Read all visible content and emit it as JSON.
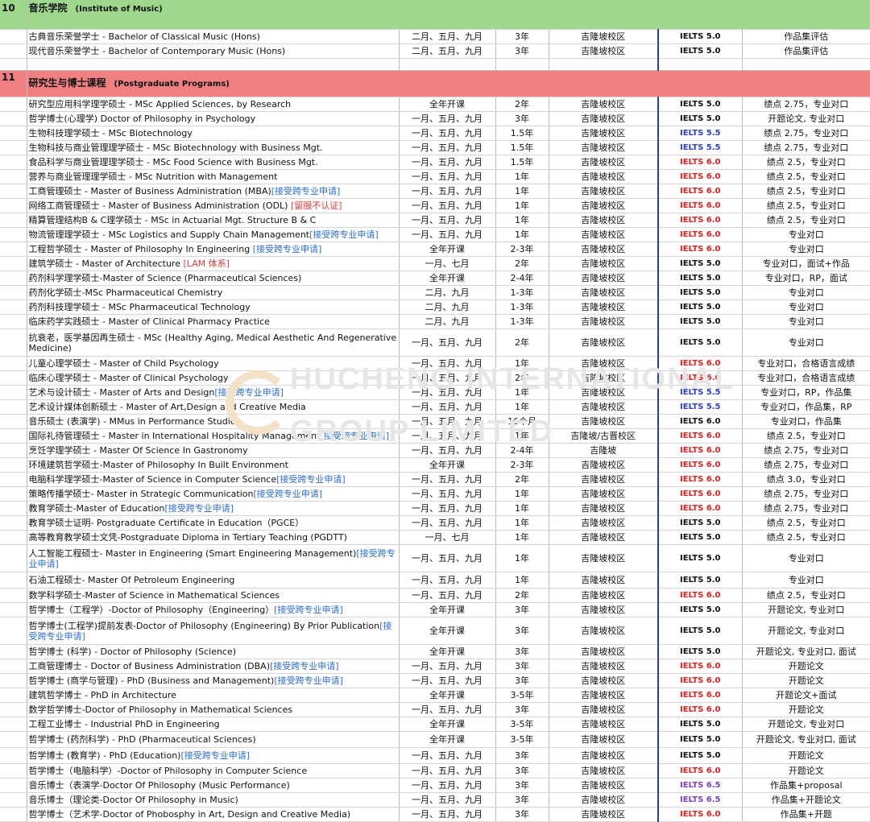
{
  "colors": {
    "section_green": "#9fd88c",
    "section_red": "#ef7f80",
    "tag_blue": "#2e6fd6",
    "tag_red": "#e03a3a",
    "ielts_red": "#e02020",
    "ielts_blue": "#2b3fd0",
    "ielts_purple": "#7a3fc0"
  },
  "watermark": {
    "line1": "HUCHENG INTERNATIONAL",
    "line2": "GROUP LIMITED"
  },
  "sections": [
    {
      "num": "10",
      "title_cn": "音乐学院",
      "title_en": "(Institute of Music)",
      "color": "green",
      "rows": [
        {
          "name": "古典音乐荣誉学士 - Bachelor of Classical Music (Hons)",
          "tag": "",
          "intake": "二月、五月、九月",
          "duration": "3年",
          "campus": "吉隆坡校区",
          "ielts": "IELTS 5.0",
          "level": "black",
          "note": "作品集评估"
        },
        {
          "name": "现代音乐荣誉学士 - Bachelor of Contemporary Music (Hons)",
          "tag": "",
          "intake": "二月、五月、九月",
          "duration": "3年",
          "campus": "吉隆坡校区",
          "ielts": "IELTS 5.0",
          "level": "black",
          "note": "作品集评估"
        }
      ]
    },
    {
      "num": "11",
      "title_cn": "研究生与博士课程",
      "title_en": "(Postgraduate Programs)",
      "color": "red",
      "rows": [
        {
          "name": "研究型应用科学理学硕士 - MSc Applied Sciences, by Research",
          "tag": "",
          "intake": "全年开课",
          "duration": "2年",
          "campus": "吉隆坡校区",
          "ielts": "IELTS 5.0",
          "level": "black",
          "note": "绩点 2.75，专业对口"
        },
        {
          "name": "哲学博士(心理学) Doctor of Philosophy in Psychology",
          "tag": "",
          "intake": "一月、五月、九月",
          "duration": "3年",
          "campus": "吉隆坡校区",
          "ielts": "IELTS 5.0",
          "level": "black",
          "note": "开题论文, 专业对口"
        },
        {
          "name": "生物科技理学硕士 - MSc Biotechnology",
          "tag": "",
          "intake": "一月、五月、九月",
          "duration": "1.5年",
          "campus": "吉隆坡校区",
          "ielts": "IELTS 5.5",
          "level": "blue",
          "note": "绩点 2.75，专业对口"
        },
        {
          "name": "生物科技与商业管理理学硕士 - MSc Biotechnology with Business Mgt.",
          "tag": "",
          "intake": "一月、五月、九月",
          "duration": "1.5年",
          "campus": "吉隆坡校区",
          "ielts": "IELTS 5.5",
          "level": "blue",
          "note": "绩点 2.75，专业对口"
        },
        {
          "name": "食品科学与商业管理理学硕士 - MSc Food Science with Business Mgt.",
          "tag": "",
          "intake": "一月、五月、九月",
          "duration": "1.5年",
          "campus": "吉隆坡校区",
          "ielts": "IELTS 6.0",
          "level": "red",
          "note": "绩点 2.5，专业对口"
        },
        {
          "name": "营养与商业管理理学硕士 - MSc Nutrition with Management",
          "tag": "",
          "intake": "一月、五月、九月",
          "duration": "1年",
          "campus": "吉隆坡校区",
          "ielts": "IELTS 6.0",
          "level": "red",
          "note": "绩点 2.5，专业对口"
        },
        {
          "name": "工商管理硕士 - Master of Business Administration (MBA)",
          "tag": "[接受跨专业申请]",
          "intake": "一月、五月、九月",
          "duration": "1年",
          "campus": "吉隆坡校区",
          "ielts": "IELTS 6.0",
          "level": "red",
          "note": "绩点 2.5，专业对口"
        },
        {
          "name": "网络工商管理硕士 - Master of Business Administration (ODL) ",
          "tag_red": "[留服不认证]",
          "intake": "一月、五月、九月",
          "duration": "1年",
          "campus": "吉隆坡校区",
          "ielts": "IELTS 6.0",
          "level": "red",
          "note": "绩点 2.5，专业对口"
        },
        {
          "name": "精算管理结构B & C理学硕士 - MSc in Actuarial Mgt. Structure B & C",
          "tag": "",
          "intake": "一月、五月、九月",
          "duration": "1年",
          "campus": "吉隆坡校区",
          "ielts": "IELTS 6.0",
          "level": "red",
          "note": "绩点 2.5，专业对口"
        },
        {
          "name": "物流管理理学硕士 - MSc Logistics and Supply Chain Management",
          "tag": "[接受跨专业申请]",
          "intake": "一月、五月、九月",
          "duration": "1年",
          "campus": "吉隆坡校区",
          "ielts": "IELTS 6.0",
          "level": "red",
          "note": "专业对口"
        },
        {
          "name": "工程哲学硕士 - Master of Philosophy In Engineering ",
          "tag": "[接受跨专业申请]",
          "intake": "全年开课",
          "duration": "2-3年",
          "campus": "吉隆坡校区",
          "ielts": "IELTS 6.0",
          "level": "red",
          "note": "专业对口"
        },
        {
          "name": "建筑学硕士 - Master of Architecture ",
          "tag_red": "[LAM 体系]",
          "intake": "一月、七月",
          "duration": "2年",
          "campus": "吉隆坡校区",
          "ielts": "IELTS 5.0",
          "level": "black",
          "note": "专业对口，面试+作品"
        },
        {
          "name": "药剂科学理学硕士-Master of Science (Pharmaceutical Sciences)",
          "tag": "",
          "intake": "全年开课",
          "duration": "2-4年",
          "campus": "吉隆坡校区",
          "ielts": "IELTS 5.0",
          "level": "black",
          "note": "专业对口，RP，面试"
        },
        {
          "name": "药剂化学硕士-MSc Pharmaceutical Chemistry",
          "tag": "",
          "intake": "二月、九月",
          "duration": "1-3年",
          "campus": "吉隆坡校区",
          "ielts": "IELTS 5.0",
          "level": "black",
          "note": "专业对口"
        },
        {
          "name": "药剂科技理学硕士 - MSc Pharmaceutical Technology",
          "tag": "",
          "intake": "二月、九月",
          "duration": "1-3年",
          "campus": "吉隆坡校区",
          "ielts": "IELTS 5.0",
          "level": "black",
          "note": "专业对口"
        },
        {
          "name": "临床药学实践硕士 - Master of Clinical Pharmacy Practice",
          "tag": "",
          "intake": "二月、九月",
          "duration": "1-3年",
          "campus": "吉隆坡校区",
          "ielts": "IELTS 5.0",
          "level": "black",
          "note": "专业对口"
        },
        {
          "name": "抗衰老，医学基因再生硕士 - MSc (Healthy Aging, Medical Aesthetic And Regenerative Medicine)",
          "tag": "",
          "intake": "一月、五月、九月",
          "duration": "2年",
          "campus": "吉隆坡校区",
          "ielts": "IELTS 5.0",
          "level": "black",
          "note": "专业对口",
          "tall": true
        },
        {
          "name": "儿童心理学硕士 - Master of Child Psychology",
          "tag": "",
          "intake": "一月、五月、九月",
          "duration": "1年",
          "campus": "吉隆坡校区",
          "ielts": "IELTS 6.0",
          "level": "red",
          "note": "专业对口，合格语言成绩"
        },
        {
          "name": "临床心理学硕士 - Master of Clinical Psychology",
          "tag": "",
          "intake": "一月、五月、九月",
          "duration": "2年",
          "campus": "吉隆坡校区",
          "ielts": "IELTS 6.0",
          "level": "red",
          "note": "专业对口，合格语言成绩"
        },
        {
          "name": "艺术与设计硕士 - Master of Arts and Design",
          "tag": "[接受跨专业申请]",
          "intake": "一月、五月、九月",
          "duration": "1年",
          "campus": "吉隆坡校区",
          "ielts": "IELTS 5.5",
          "level": "blue",
          "note": "专业对口，RP，作品集"
        },
        {
          "name": "艺术设计媒体创新硕士 - Master of Art,Design and Creative Media",
          "tag": "",
          "intake": "一月、五月、九月",
          "duration": "1年",
          "campus": "吉隆坡校区",
          "ielts": "IELTS 5.5",
          "level": "blue",
          "note": "专业对口，作品集，RP"
        },
        {
          "name": "音乐硕士 (表演学) - MMus in Performance Studies",
          "tag": "",
          "intake": "一月、五月、九月",
          "duration": "16个月",
          "campus": "吉隆坡校区",
          "ielts": "IELTS 6.0",
          "level": "black",
          "note": "专业对口，作品集"
        },
        {
          "name": "国际礼待管理硕士 - Master in International Hospitality Management",
          "tag": "[接受跨专业申请]",
          "intake": "一月、五月、九月",
          "duration": "1年",
          "campus": "吉隆坡/古晋校区",
          "ielts": "IELTS 6.0",
          "level": "red",
          "note": "绩点 2.5，专业对口"
        },
        {
          "name": "烹饪学理学硕士 - Master Of Science In Gastronomy",
          "tag": "",
          "intake": "一月、五月、九月",
          "duration": "2-4年",
          "campus": "吉隆坡",
          "ielts": "IELTS 6.0",
          "level": "red",
          "note": "绩点 2.75，专业对口"
        },
        {
          "name": "环境建筑哲学硕士-Master of Philosophy In Built Environment",
          "tag": "",
          "intake": "全年开课",
          "duration": "2-3年",
          "campus": "吉隆坡校区",
          "ielts": "IELTS 6.0",
          "level": "red",
          "note": "绩点 2.75，专业对口"
        },
        {
          "name": "电脑科学理学硕士-Master of Science in Computer Science",
          "tag": "[接受跨专业申请]",
          "intake": "一月、五月、九月",
          "duration": "2年",
          "campus": "吉隆坡校区",
          "ielts": "IELTS 6.0",
          "level": "red",
          "note": "绩点 3.0，专业对口"
        },
        {
          "name": "策略传播学硕士- Master in Strategic Communication",
          "tag": "[接受跨专业申请]",
          "intake": "一月、五月、九月",
          "duration": "1年",
          "campus": "吉隆坡校区",
          "ielts": "IELTS 6.0",
          "level": "red",
          "note": "绩点 2.75，专业对口"
        },
        {
          "name": "教育学硕士-Master of Education",
          "tag": "[接受跨专业申请]",
          "intake": "一月、五月、九月",
          "duration": "1年",
          "campus": "吉隆坡校区",
          "ielts": "IELTS 6.0",
          "level": "red",
          "note": "绩点 2.75，专业对口"
        },
        {
          "name": "教育学硕士证明- Postgraduate Certificate in Education（PGCE）",
          "tag": "",
          "intake": "一月、五月、九月",
          "duration": "1年",
          "campus": "吉隆坡校区",
          "ielts": "IELTS 5.0",
          "level": "black",
          "note": "绩点 2.5，专业对口"
        },
        {
          "name": "高等教育教学硕士文凭-Postgraduate Diploma in Tertiary Teaching (PGDTT)",
          "tag": "",
          "intake": "一月、七月",
          "duration": "1年",
          "campus": "吉隆坡校区",
          "ielts": "IELTS 5.0",
          "level": "black",
          "note": "绩点 2.5，专业对口"
        },
        {
          "name": "人工智能工程硕士- Master in Engineering (Smart Engineering Management)",
          "tag": "[接受跨专业申请]",
          "intake": "一月、五月、九月",
          "duration": "1年",
          "campus": "吉隆坡校区",
          "ielts": "IELTS 5.0",
          "level": "black",
          "note": "专业对口",
          "tall": true
        },
        {
          "name": "石油工程硕士- Master Of Petroleum Engineering",
          "tag": "",
          "intake": "一月、五月、九月",
          "duration": "1年",
          "campus": "吉隆坡校区",
          "ielts": "IELTS 5.0",
          "level": "black",
          "note": "专业对口",
          "mid": true
        },
        {
          "name": "数学科学硕士-Master of Science in Mathematical Sciences",
          "tag": "",
          "intake": "一月、五月、九月",
          "duration": "2年",
          "campus": "吉隆坡校区",
          "ielts": "IELTS 6.0",
          "level": "red",
          "note": "绩点 2.5，专业对口"
        },
        {
          "name": "哲学博士（工程学）-Doctor of Philosophy（Engineering）",
          "tag": "[接受跨专业申请]",
          "intake": "全年开课",
          "duration": "3年",
          "campus": "吉隆坡校区",
          "ielts": "IELTS 5.0",
          "level": "black",
          "note": "开题论文, 专业对口"
        },
        {
          "name": "哲学博士(工程学)提前发表-Doctor of Philosophy (Engineering) By Prior Publication",
          "tag": "[接受跨专业申请]",
          "intake": "全年开课",
          "duration": "3年",
          "campus": "吉隆坡校区",
          "ielts": "IELTS 5.0",
          "level": "black",
          "note": "开题论文, 专业对口",
          "tall": true
        },
        {
          "name": "哲学博士 (科学) - Doctor of Philosophy (Science)",
          "tag": "",
          "intake": "全年开课",
          "duration": "3年",
          "campus": "吉隆坡校区",
          "ielts": "IELTS 5.0",
          "level": "black",
          "note": "开题论文, 专业对口, 面试"
        },
        {
          "name": "工商管理博士 - Doctor of Business Administration (DBA)",
          "tag": "[接受跨专业申请]",
          "intake": "一月、五月、九月",
          "duration": "3年",
          "campus": "吉隆坡校区",
          "ielts": "IELTS 6.0",
          "level": "red",
          "note": "开题论文"
        },
        {
          "name": "哲学博士 (商学与管理) - PhD (Business and Management)",
          "tag": "[接受跨专业申请]",
          "intake": "一月、五月、九月",
          "duration": "3年",
          "campus": "吉隆坡校区",
          "ielts": "IELTS 6.0",
          "level": "red",
          "note": "开题论文"
        },
        {
          "name": "建筑哲学博士 - PhD in Architecture",
          "tag": "",
          "intake": "全年开课",
          "duration": "3-5年",
          "campus": "吉隆坡校区",
          "ielts": "IELTS 6.0",
          "level": "red",
          "note": "开题论文+面试"
        },
        {
          "name": "数学哲学博士-Doctor of Philosophy in Mathematical Sciences",
          "tag": "",
          "intake": "一月、五月、九月",
          "duration": "3年",
          "campus": "吉隆坡校区",
          "ielts": "IELTS 6.0",
          "level": "red",
          "note": "开题论文"
        },
        {
          "name": "工程工业博士 - Industrial PhD in Engineering",
          "tag": "",
          "intake": "全年开课",
          "duration": "3-5年",
          "campus": "吉隆坡校区",
          "ielts": "IELTS 5.0",
          "level": "black",
          "note": "开题论文, 专业对口"
        },
        {
          "name": "哲学博士 (药剂科学) - PhD (Pharmaceutical Sciences)",
          "tag": "",
          "intake": "全年开课",
          "duration": "3-5年",
          "campus": "吉隆坡校区",
          "ielts": "IELTS 5.0",
          "level": "black",
          "note": "开题论文, 专业对口, 面试",
          "mid": true
        },
        {
          "name": "哲学博士 (教育学) - PhD (Education)",
          "tag": "[接受跨专业申请]",
          "intake": "一月、五月、九月",
          "duration": "3年",
          "campus": "吉隆坡校区",
          "ielts": "IELTS 5.0",
          "level": "black",
          "note": "开题论文",
          "mid": true
        },
        {
          "name": "哲学博士（电脑科学）-Doctor of Philosophy in Computer Science",
          "tag": "",
          "intake": "一月、五月、九月",
          "duration": "3年",
          "campus": "吉隆坡校区",
          "ielts": "IELTS 6.0",
          "level": "red",
          "note": "开题论文"
        },
        {
          "name": "音乐博士（表演学-Doctor Of Philosophy (Music Performance)",
          "tag": "",
          "intake": "一月、五月、九月",
          "duration": "3年",
          "campus": "吉隆坡校区",
          "ielts": "IELTS 6.5",
          "level": "purple",
          "note": "作品集+proposal"
        },
        {
          "name": "音乐博士（理论类-Doctor Of Philosophy in Music)",
          "tag": "",
          "intake": "一月、五月、九月",
          "duration": "3年",
          "campus": "吉隆坡校区",
          "ielts": "IELTS 6.5",
          "level": "purple",
          "note": "作品集+开题论文"
        },
        {
          "name": "哲学博士（艺术学-Doctor of Phobosphy in Art, Design and Creative Media)",
          "tag": "",
          "intake": "一月、五月、九月",
          "duration": "3年",
          "campus": "吉隆坡校区",
          "ielts": "IELTS 6.0",
          "level": "red",
          "note": "作品集+开题"
        }
      ]
    }
  ]
}
